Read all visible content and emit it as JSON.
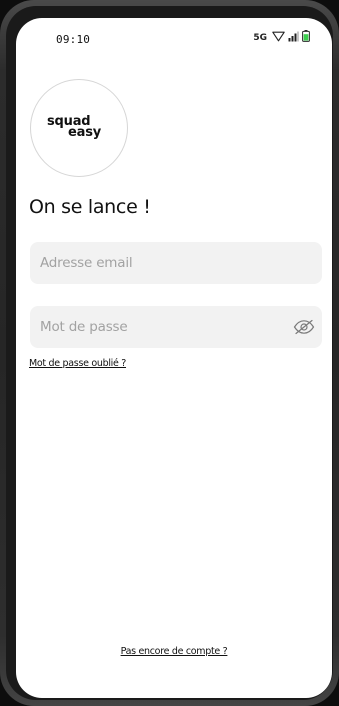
{
  "status_bar": {
    "time": "09:10",
    "network": "5G",
    "icons": [
      "wifi-icon",
      "signal-icon",
      "battery-icon"
    ],
    "battery_color": "#3ccf4e"
  },
  "logo": {
    "line1": "squad",
    "line2": "easy"
  },
  "headline": "On se lance !",
  "form": {
    "email_placeholder": "Adresse email",
    "password_placeholder": "Mot de passe",
    "password_toggle_icon": "eye-off-icon",
    "forgot_password": "Mot de passe oublié ?"
  },
  "footer": {
    "signup_link": "Pas encore de compte ?"
  }
}
